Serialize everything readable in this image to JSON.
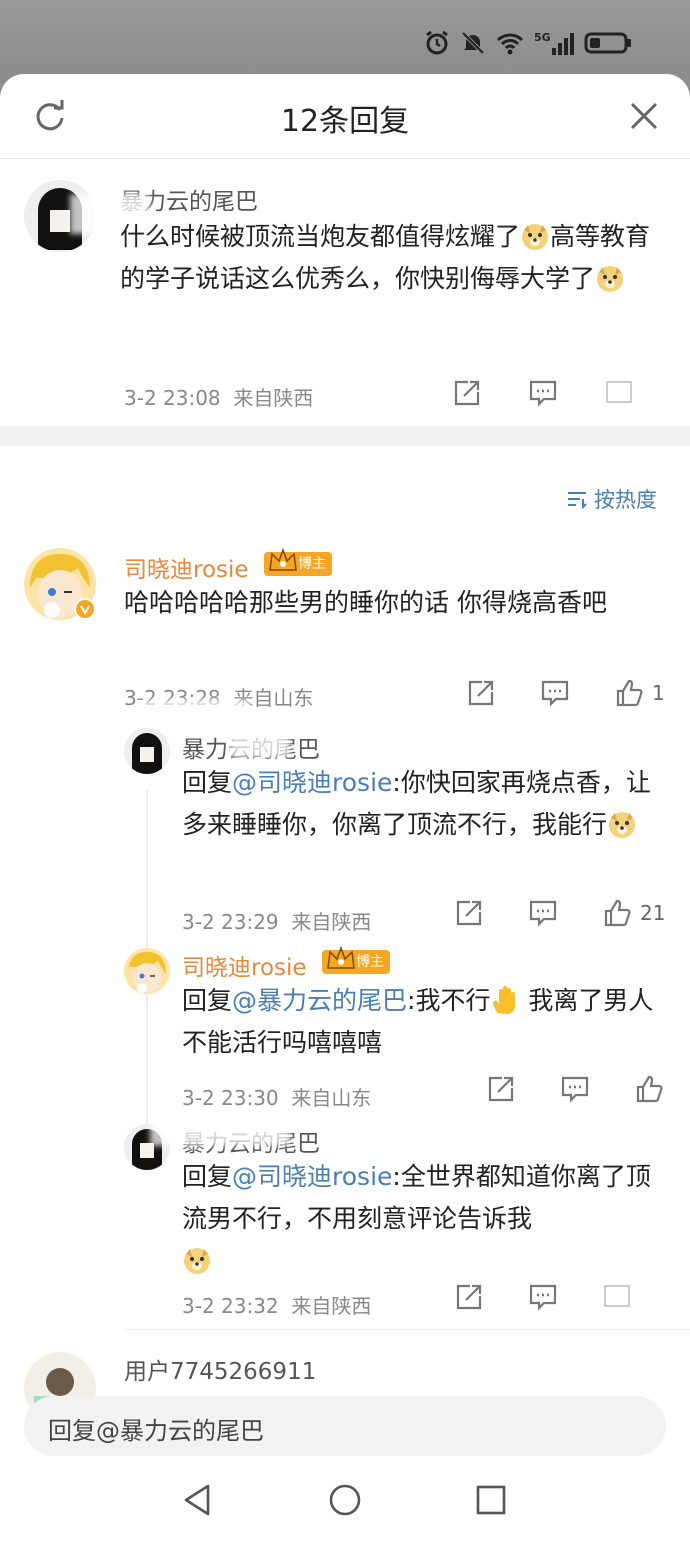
{
  "sheet": {
    "title": "12条回复"
  },
  "main_comment": {
    "name": "暴力云的尾巴",
    "text_parts": [
      "什么时候被顶流当炮友都值得炫耀了",
      "高等教育的学子说话这么优秀么，你快别侮辱大学了"
    ],
    "time": "3-2 23:08",
    "location": "来自陕西"
  },
  "sort": {
    "label": "按热度"
  },
  "reply1": {
    "name": "司晓迪rosie",
    "badge": "博主",
    "text": "哈哈哈哈哈那些男的睡你的话 你得烧高香吧",
    "time": "3-2 23:28",
    "location": "来自山东",
    "likes": "1"
  },
  "sub1": {
    "name": "暴力云的尾巴",
    "reply_prefix": "回复",
    "mention": "@司晓迪rosie",
    "text": ":你快回家再烧点香，让多来睡睡你，你离了顶流不行，我能行",
    "time": "3-2 23:29",
    "location": "来自陕西",
    "likes": "21"
  },
  "sub2": {
    "name": "司晓迪rosie",
    "badge": "博主",
    "reply_prefix": "回复",
    "mention": "@暴力云的尾巴",
    "text_a": ":我不行",
    "text_b": " 我离了男人不能活行吗嘻嘻嘻",
    "time": "3-2 23:30",
    "location": "来自山东"
  },
  "sub3": {
    "name": "暴力云的尾巴",
    "reply_prefix": "回复",
    "mention": "@司晓迪rosie",
    "text": ":全世界都知道你离了顶流男不行，不用刻意评论告诉我",
    "time": "3-2 23:32",
    "location": "来自陕西"
  },
  "next_comment": {
    "name": "用户7745266911"
  },
  "reply_input": {
    "placeholder": "回复@暴力云的尾巴"
  },
  "colors": {
    "accent_blue": "#4a7fb5",
    "name_orange": "#e8883b",
    "badge": "#f6a623"
  },
  "icons": [
    "alarm-icon",
    "mute-icon",
    "wifi-icon",
    "signal-5g-icon",
    "battery-icon",
    "refresh-icon",
    "close-icon",
    "repost-icon",
    "comment-icon",
    "like-icon",
    "sort-icon",
    "doge-emoji",
    "hand-emoji",
    "back-icon",
    "home-icon",
    "recent-apps-icon"
  ]
}
